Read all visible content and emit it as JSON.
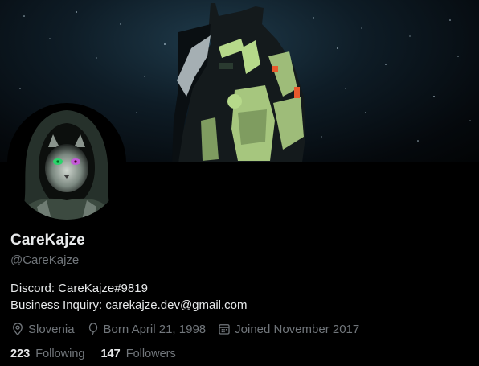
{
  "profile": {
    "display_name": "CareKajze",
    "handle": "@CareKajze",
    "bio_lines": [
      "Discord: CareKajze#9819",
      "Business Inquiry: carekajze.dev@gmail.com"
    ],
    "location": "Slovenia",
    "birthday": "Born April 21, 1998",
    "joined": "Joined November 2017",
    "following_count": "223",
    "following_label": "Following",
    "followers_count": "147",
    "followers_label": "Followers"
  },
  "icons": {
    "location": "location-pin-icon",
    "birthday": "balloon-icon",
    "joined": "calendar-icon"
  },
  "colors": {
    "background": "#000000",
    "primary_text": "#e7e9ea",
    "secondary_text": "#71767b",
    "astronaut_green": "#b6d98a"
  }
}
